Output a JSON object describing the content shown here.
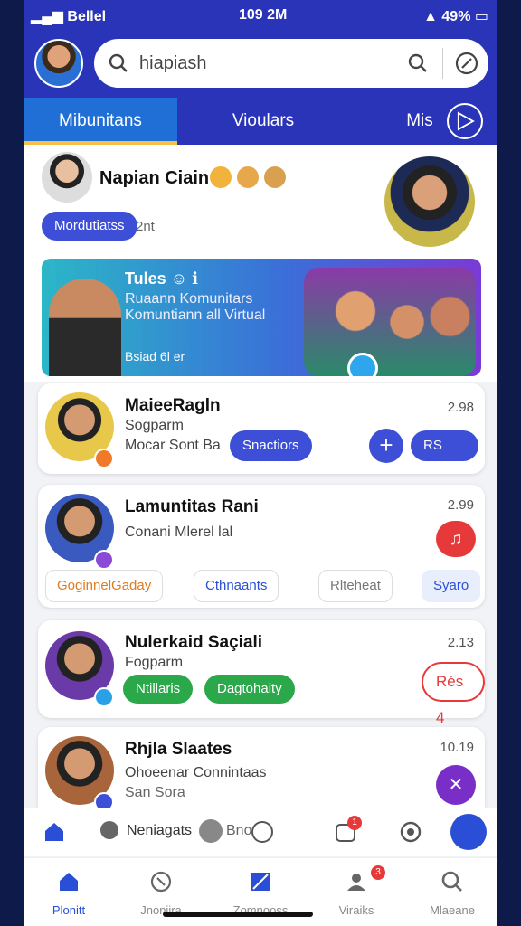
{
  "status": {
    "carrier": "Bellel",
    "time": "109 2M",
    "battery": "49%"
  },
  "search": {
    "value": "hiapiash",
    "placeholder": ""
  },
  "tabs": [
    {
      "label": "Mibunitans",
      "active": true
    },
    {
      "label": "Vioulars",
      "active": false
    },
    {
      "label": "Mis",
      "active": false
    }
  ],
  "hero": {
    "name": "Napian Ciain",
    "tag": "Mordutiatss",
    "time": "2nt",
    "banner": {
      "title": "Tules",
      "subtitle": "Ruaann Komunitars Komuntiann all Virtual",
      "tag": "Bsiad 6l er"
    }
  },
  "cards": [
    {
      "name": "MaieeRagln",
      "sub": "Sogparm",
      "detail": "Mocar Sont Ba",
      "time": "2.98",
      "button": "Snactiors",
      "button2": "RS"
    },
    {
      "name": "Lamuntitas Rani",
      "sub": "Conani Mlerel lal",
      "time": "2.99",
      "chips": [
        "GoginnelGaday",
        "Cthnaants",
        "Rlteheat",
        "Syaro"
      ]
    },
    {
      "name": "Nulerkaid Saçiali",
      "sub": "Fogparm",
      "time": "2.13",
      "green_buttons": [
        "Ntillaris",
        "Dagtohaity"
      ],
      "outline_button": "Rés 4"
    },
    {
      "name": "Rhjla Slaates",
      "sub": "Ohoeenar Connintaas",
      "detail": "San Sora",
      "time": "10.19"
    }
  ],
  "actions": {
    "label": "Neniagats",
    "label2": "Bno",
    "badge": "1"
  },
  "nav": [
    {
      "label": "Plonitt",
      "icon": "home-icon",
      "active": true
    },
    {
      "label": "Jnoniira",
      "icon": "clock-icon",
      "active": false
    },
    {
      "label": "Zomnooss",
      "icon": "edit-icon",
      "active": false
    },
    {
      "label": "Viraiks",
      "icon": "group-icon",
      "active": false,
      "badge": "3"
    },
    {
      "label": "Mlaeane",
      "icon": "search-icon",
      "active": false
    }
  ],
  "colors": {
    "primary": "#2a34b8",
    "accent": "#3d4fd6",
    "tab_active": "#1f6fd6",
    "underline": "#f5c04a",
    "red": "#e63a3a",
    "green": "#2aa84a"
  }
}
